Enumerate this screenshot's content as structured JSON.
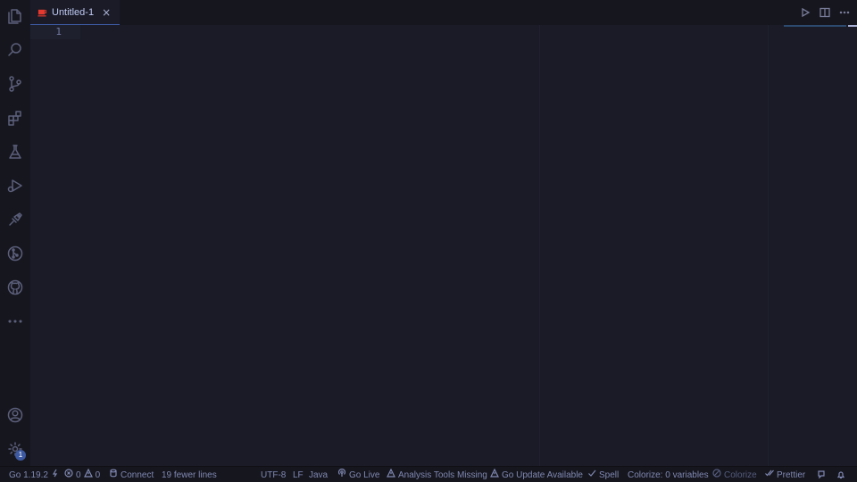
{
  "activity_bar": {
    "icons": [
      "explorer-icon",
      "search-icon",
      "source-control-icon",
      "extensions-icon",
      "testing-icon",
      "run-debug-icon",
      "remote-explorer-icon",
      "gitlens-icon",
      "github-icon",
      "more-icon",
      "account-icon",
      "manage-gear-icon"
    ],
    "settings_badge": "1"
  },
  "tabs": [
    {
      "title": "Untitled-1",
      "close": "×",
      "icon": "java-coffee-icon",
      "active": true
    }
  ],
  "editor": {
    "line_numbers": [
      "1"
    ]
  },
  "status_bar": {
    "go_version": "Go 1.19.2",
    "errors": "0",
    "warnings": "0",
    "connect": "Connect",
    "line_diff": "19 fewer lines",
    "encoding": "UTF-8",
    "eol": "LF",
    "language": "Java",
    "go_live": "Go Live",
    "analysis_tools": "Analysis Tools Missing",
    "go_update": "Go Update Available",
    "spell": "Spell",
    "colorize_vars": "Colorize: 0 variables",
    "colorize": "Colorize",
    "prettier": "Prettier"
  },
  "colors": {
    "background": "#1a1b26",
    "sidebar": "#16161e",
    "accent": "#3d59a1",
    "java_icon": "#e5392f"
  }
}
